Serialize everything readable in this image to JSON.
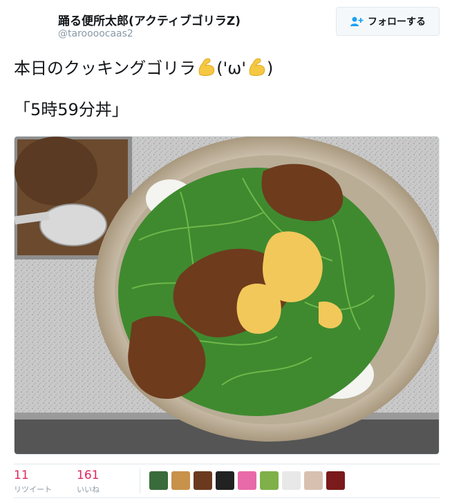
{
  "user": {
    "display_name": "踊る便所太郎(アクティブゴリラZ)",
    "handle": "@taroooocaas2"
  },
  "follow_button": {
    "label": "フォローする",
    "icon": "add-user-icon"
  },
  "tweet": {
    "text_line1": "本日のクッキングゴリラ",
    "kaomoji": "('ω'",
    "text_line1_end": ")",
    "text_line2": "「5時59分丼」",
    "emoji": "flexed-biceps-emoji"
  },
  "photo": {
    "alt": ""
  },
  "stats": {
    "retweets": {
      "count": "11",
      "label": "リツイート"
    },
    "likes": {
      "count": "161",
      "label": "いいね"
    }
  },
  "likers": [
    {
      "icon": "liker-avatar-1",
      "color": "#3a6b3a"
    },
    {
      "icon": "liker-avatar-2",
      "color": "#c8924a"
    },
    {
      "icon": "liker-avatar-3",
      "color": "#6b3a1e"
    },
    {
      "icon": "liker-avatar-4",
      "color": "#222222"
    },
    {
      "icon": "liker-avatar-5",
      "color": "#e86aa8"
    },
    {
      "icon": "liker-avatar-6",
      "color": "#7fb04a"
    },
    {
      "icon": "liker-avatar-7",
      "color": "#e8e8e8"
    },
    {
      "icon": "liker-avatar-8",
      "color": "#d8c0b0"
    },
    {
      "icon": "liker-avatar-9",
      "color": "#7a1a1a"
    }
  ],
  "colors": {
    "accent": "#1da1f2",
    "like": "#e0245e",
    "muted": "#8899a6"
  }
}
